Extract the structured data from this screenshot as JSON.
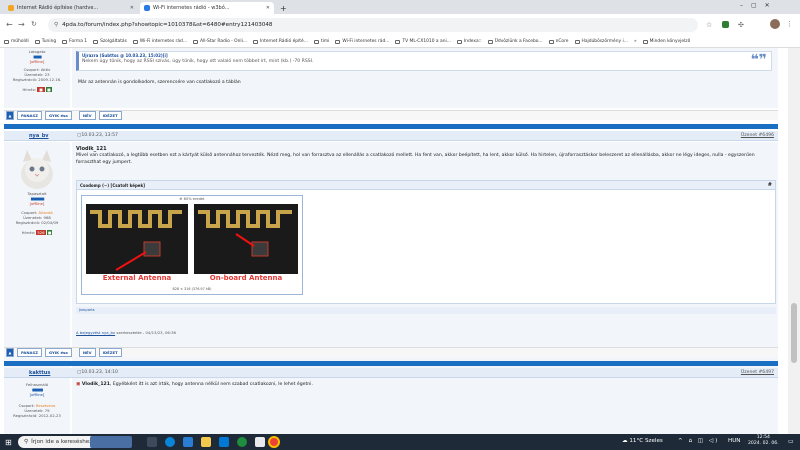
{
  "browser": {
    "tabs": [
      {
        "title": "Internet Rádió építése (hardve...",
        "active": false
      },
      {
        "title": "Wi-Fi internetes rádió - w3bó́...",
        "active": true
      }
    ],
    "new_tab": "+",
    "url": "4pda.to/forum/index.php?showtopic=1010378&st=6480#entry121403048",
    "bookmarks": [
      "műholdi",
      "Tuning",
      "Forma 1",
      "Szolgáltatás",
      "Wi-Fi internetes rád...",
      "All-Star Radio - Onli...",
      "Internet Rádió építé...",
      "timi",
      "Wi-Fi internetes rád...",
      "TV ML-CX1010 a ani...",
      "Indexa::",
      "Üdvözlünk a Facebo...",
      "nCore",
      "Hajdúböszörmény i...",
      "»",
      "Minden könyvjelző"
    ]
  },
  "post_top": {
    "username": "Latogato",
    "status": "[offline]",
    "group": "Csoport: Aktív",
    "messages": "Üzenetek: 23",
    "registered": "Regisztráció: 2009.12.16.",
    "rep_label": "Hírnév:",
    "quote_header": "Ujrazra (Subttss @ 10.03.23, 15:02)[i]",
    "quote_text": "Nekem úgy tűnik, hogy az RSSI szívás, úgy tűnik, hogy ott valaló nem többet írt, mint (kb.) -70 RSSI.",
    "body": "Már az antennán is gondolkodom, szerencsére van csatlakozó a táblán"
  },
  "buttons": [
    "PANASZ",
    "GYIK ésa",
    "NÉV",
    "IDÉZET"
  ],
  "post_main": {
    "username": "nya_bv",
    "date": "▢10.03.23, 13:57",
    "msg_num": "Üzenet #6496",
    "rank": "Tapasztalt",
    "status": "[offline]",
    "group_label": "Csoport: ",
    "group_value": "Állandó",
    "messages": "Üzenetek: 968",
    "registered": "Regisztráció: 02/04/09",
    "rep_label": "Hírnév: ",
    "rep_value": "526",
    "quote_author": "Vlodik_121",
    "body": "Mivel van csatlakozó, a legtöbb esetben ezt a kártyát külső antennához tervezték. Nézd meg, hol van forrasztva az ellenállás a csatlakozó mellett. Ha fent van, akkor beépített, ha lent, akkor külső. Ha hirtelen, újraforrasztáskor beleszeret az ellenállásba, akkor ne légy ideges, nulla - egyszerűen forraszthat egy jumpert.",
    "spoiler_title": "Csodomp (~) [Csatolt képek]",
    "spoiler_hash": "#",
    "img_caption": "60% eredet",
    "label_ext": "External Antenna",
    "label_onboard": "On-board Antenna",
    "img_size": "828 × 316 (376.97 kB)",
    "footer_small": "Jsmparts",
    "edit_note_link": "A bejegyzést nya_bv",
    "edit_note_rest": " szerkesztette - 04/13/23, 06:36"
  },
  "post_bottom": {
    "username": "kakttus",
    "date": "▢10.03.23, 14:10",
    "msg_num": "Üzenet #6497",
    "rank": "Felhasználó",
    "status": "[offline]",
    "group_label": "Csoport: ",
    "group_value": "Resztvevo",
    "messages": "Üzenetek: 79",
    "registered": "Regisztráció: 2012-02-23",
    "quote_author": "Vlodik_121",
    "body": ", Egyébként itt is azt írták, hogy antenna nélkül nem szabad csatlakozni, le lehet égetni."
  },
  "taskbar": {
    "search_placeholder": "Írjon ide a kereséshez",
    "weather": "11°C Szeles",
    "lang": "HUN",
    "time": "12:54",
    "date": "2024. 02. 06."
  },
  "colors": {
    "accent": "#1a6fc3",
    "link": "#1a4f9c"
  }
}
